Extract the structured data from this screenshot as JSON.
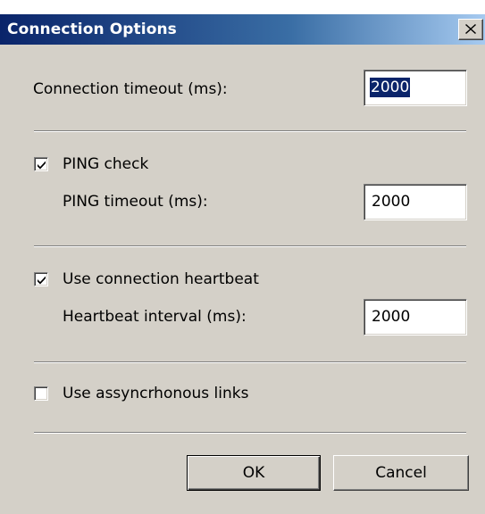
{
  "dialog": {
    "title": "Connection Options",
    "close_glyph": "close-icon"
  },
  "connection_timeout": {
    "label": "Connection timeout (ms):",
    "value": "2000",
    "selected": true
  },
  "ping": {
    "checkbox_label": "PING check",
    "checked": true,
    "timeout_label": "PING timeout (ms):",
    "timeout_value": "2000"
  },
  "heartbeat": {
    "checkbox_label": "Use connection heartbeat",
    "checked": true,
    "interval_label": "Heartbeat interval (ms):",
    "interval_value": "2000"
  },
  "async_links": {
    "checkbox_label": "Use assyncrhonous links",
    "checked": false
  },
  "buttons": {
    "ok_label": "OK",
    "cancel_label": "Cancel"
  },
  "colors": {
    "face": "#d4d0c8",
    "title_start": "#0a246a",
    "title_end": "#a6caf0",
    "selection": "#0a246a"
  }
}
